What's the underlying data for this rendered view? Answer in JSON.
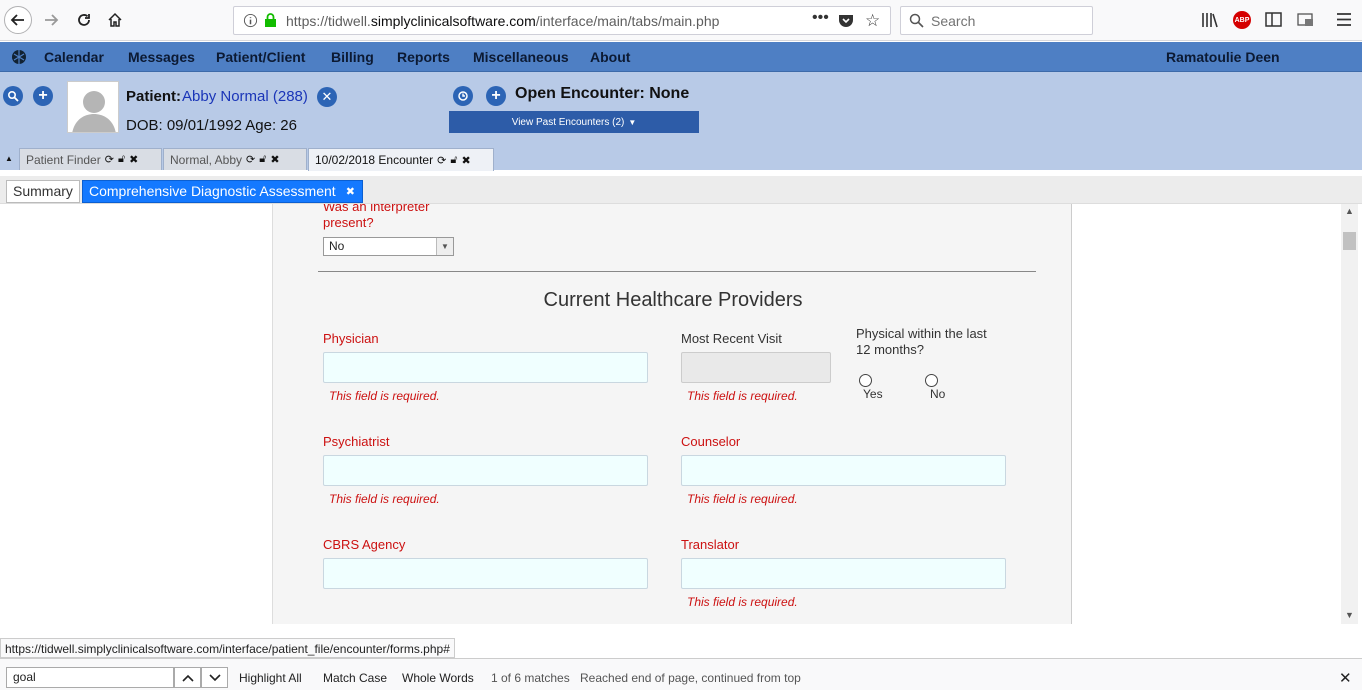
{
  "browser": {
    "url_prefix": "https://tidwell.",
    "url_domain": "simplyclinicalsoftware.com",
    "url_path": "/interface/main/tabs/main.php",
    "search_placeholder": "Search"
  },
  "menu": {
    "items": [
      "Calendar",
      "Messages",
      "Patient/Client",
      "Billing",
      "Reports",
      "Miscellaneous",
      "About"
    ],
    "user": "Ramatoulie Deen"
  },
  "patient": {
    "label": "Patient:",
    "name": "Abby Normal (288)",
    "dob_line": "DOB: 09/01/1992 Age: 26",
    "open_encounter": "Open Encounter: None",
    "view_past": "View Past Encounters  (2)"
  },
  "tabs": [
    {
      "label": "Patient Finder"
    },
    {
      "label": "Normal, Abby"
    },
    {
      "label": "10/02/2018 Encounter"
    }
  ],
  "subtabs": {
    "summary": "Summary",
    "active": "Comprehensive Diagnostic Assessment"
  },
  "form": {
    "interpreter_label_1": "Was an interpreter",
    "interpreter_label_2": "present?",
    "interpreter_value": "No",
    "section_title": "Current Healthcare Providers",
    "physician": "Physician",
    "most_recent_visit": "Most Recent Visit",
    "physical_label_1": "Physical within the last",
    "physical_label_2": "12 months?",
    "yes": "Yes",
    "no": "No",
    "psychiatrist": "Psychiatrist",
    "counselor": "Counselor",
    "cbrs_agency": "CBRS Agency",
    "translator": "Translator",
    "required": "This field is required."
  },
  "status_url": "https://tidwell.simplyclinicalsoftware.com/interface/patient_file/encounter/forms.php#",
  "find": {
    "query": "goal",
    "highlight_all": "Highlight All",
    "match_case": "Match Case",
    "whole_words": "Whole Words",
    "matches": "1 of 6 matches",
    "status": "Reached end of page, continued from top"
  }
}
